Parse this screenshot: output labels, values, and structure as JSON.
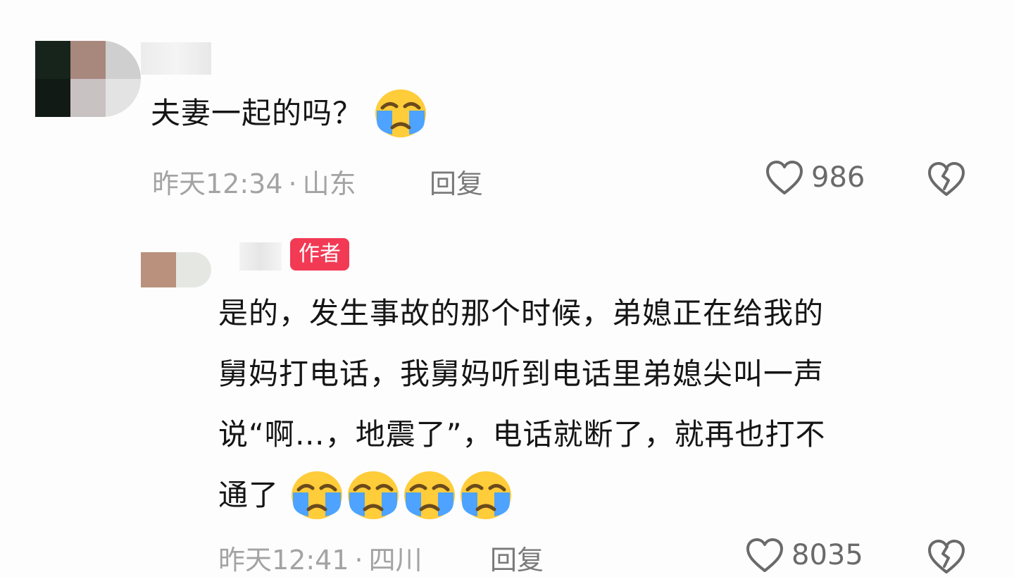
{
  "comments": [
    {
      "text": "夫妻一起的吗？",
      "time": "昨天12:34",
      "location": "山东",
      "reply_label": "回复",
      "likes": "986"
    },
    {
      "author_badge": "作者",
      "text_lines": [
        "是的，发生事故的那个时候，弟媳正在给我的",
        "舅妈打电话，我舅妈听到电话里弟媳尖叫一声",
        "说“啊…，地震了”，电话就断了，就再也打不",
        "通了"
      ],
      "time": "昨天12:41",
      "location": "四川",
      "reply_label": "回复",
      "likes": "8035"
    }
  ],
  "icons": {
    "emoji": "loudly-crying-face-emoji",
    "like": "heart-outline-icon",
    "dislike": "broken-heart-icon"
  },
  "colors": {
    "badge": "#f23a55",
    "meta_text": "#a3a3a3",
    "emoji_yellow": "#ffcc3a",
    "tear_blue": "#4da3ff"
  }
}
